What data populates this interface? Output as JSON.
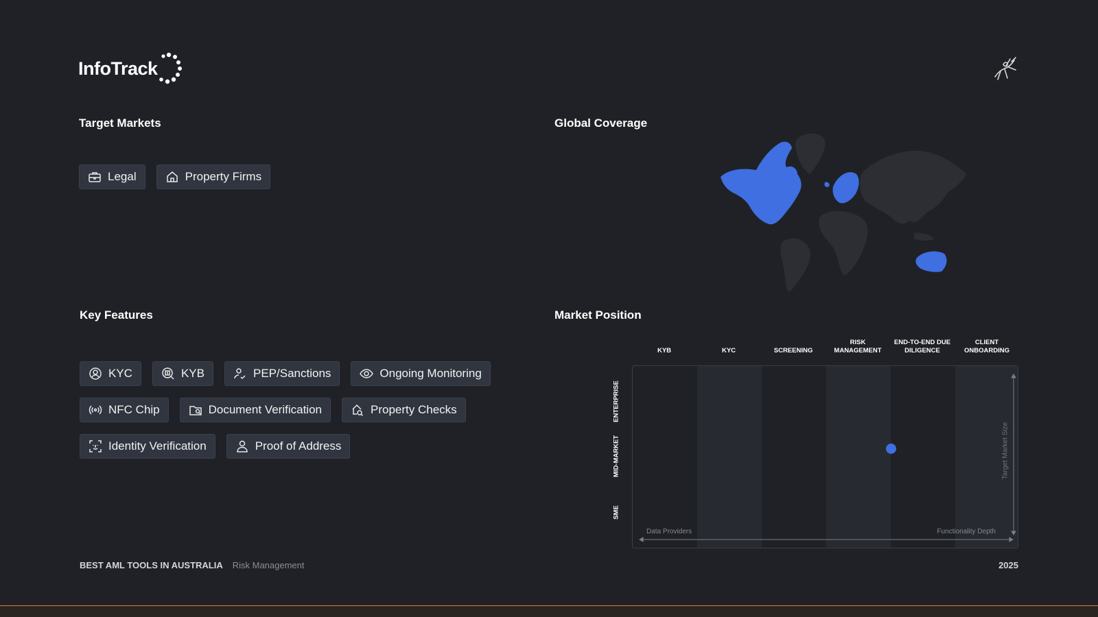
{
  "brand": {
    "logo_text": "InfoTrack",
    "logo_icon": "dotted-circle-logo",
    "corner_icon": "horse-rider-icon"
  },
  "target_markets": {
    "title": "Target Markets",
    "items": [
      {
        "label": "Legal",
        "icon": "briefcase-icon"
      },
      {
        "label": "Property Firms",
        "icon": "house-icon"
      }
    ]
  },
  "global_coverage": {
    "title": "Global Coverage",
    "highlighted_regions": [
      "North America",
      "Europe",
      "Australia"
    ],
    "highlight_color": "#3f6fe0"
  },
  "key_features": {
    "title": "Key Features",
    "items": [
      {
        "label": "KYC",
        "icon": "user-circle-icon"
      },
      {
        "label": "KYB",
        "icon": "building-search-icon"
      },
      {
        "label": "PEP/Sanctions",
        "icon": "user-check-icon"
      },
      {
        "label": "Ongoing Monitoring",
        "icon": "eye-icon"
      },
      {
        "label": "NFC Chip",
        "icon": "nfc-signal-icon"
      },
      {
        "label": "Document Verification",
        "icon": "folder-search-icon"
      },
      {
        "label": "Property Checks",
        "icon": "house-search-icon"
      },
      {
        "label": "Identity Verification",
        "icon": "face-scan-icon"
      },
      {
        "label": "Proof of Address",
        "icon": "user-location-icon"
      }
    ]
  },
  "market_position": {
    "title": "Market Position",
    "columns": [
      "KYB",
      "KYC",
      "SCREENING",
      "RISK MANAGEMENT",
      "END-TO-END DUE DILIGENCE",
      "CLIENT ONBOARDING"
    ],
    "rows": [
      "ENTERPRISE",
      "MID-MARKET",
      "SME"
    ],
    "x_axis_left": "Data Providers",
    "x_axis_right": "Functionality Depth",
    "y_axis": "Target Market Size",
    "position": {
      "column": "RISK MANAGEMENT",
      "row": "MID-MARKET",
      "x_fraction": 1.0,
      "y_fraction": 0.45
    },
    "dot_color": "#3f6fe0"
  },
  "footer": {
    "title": "BEST AML TOOLS IN AUSTRALIA",
    "category": "Risk Management",
    "year": "2025"
  }
}
